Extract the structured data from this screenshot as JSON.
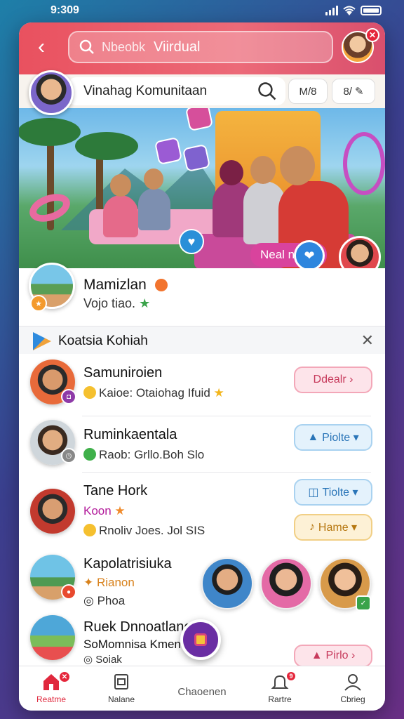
{
  "status": {
    "time": "9:309"
  },
  "header": {
    "back_label": "‹",
    "search_placeholder": "Nbeobk",
    "search_query": "Viirdual",
    "profile_badge": "✕"
  },
  "community": {
    "title": "Vinahag Komunitaan",
    "chip_1": "M/8",
    "chip_2": "8/"
  },
  "hero": {
    "tag_label": "Neal n"
  },
  "featured": {
    "name": "Mamizlan",
    "subtitle": "Vojo tiao."
  },
  "section": {
    "title": "Koatsia Kohiah",
    "close_label": "✕"
  },
  "rows": [
    {
      "name": "Samuniroien",
      "subtitle": "Kaioe: Otaiohag Ifuid",
      "action": "Ddealr ›"
    },
    {
      "name": "Ruminkaentala",
      "subtitle": "Raob: Grllo.Boh Slo",
      "action": "Piolte ▾"
    },
    {
      "name": "Tane Hork",
      "tag": "Koon",
      "subtitle": "Rnoliv Joes. Jol SIS",
      "action": "Tiolte ▾",
      "action2": "Hame ▾"
    },
    {
      "name": "Kapolatrisiuka",
      "tag": "Rianon",
      "subtitle": "Phoa"
    },
    {
      "name": "Ruek Dnnoatlane",
      "tag": "SoMomnisa Kmen",
      "subtitle": "Soiak",
      "action": "Pirlo ›"
    }
  ],
  "nav": [
    {
      "label": "Reatme"
    },
    {
      "label": "Nalane"
    },
    {
      "label": "Chaoenen"
    },
    {
      "label": "Rartre"
    },
    {
      "label": "Cbrieg"
    }
  ],
  "colors": {
    "accent": "#e9515f",
    "active_nav": "#e0283d",
    "purple": "#6a2ea3"
  }
}
